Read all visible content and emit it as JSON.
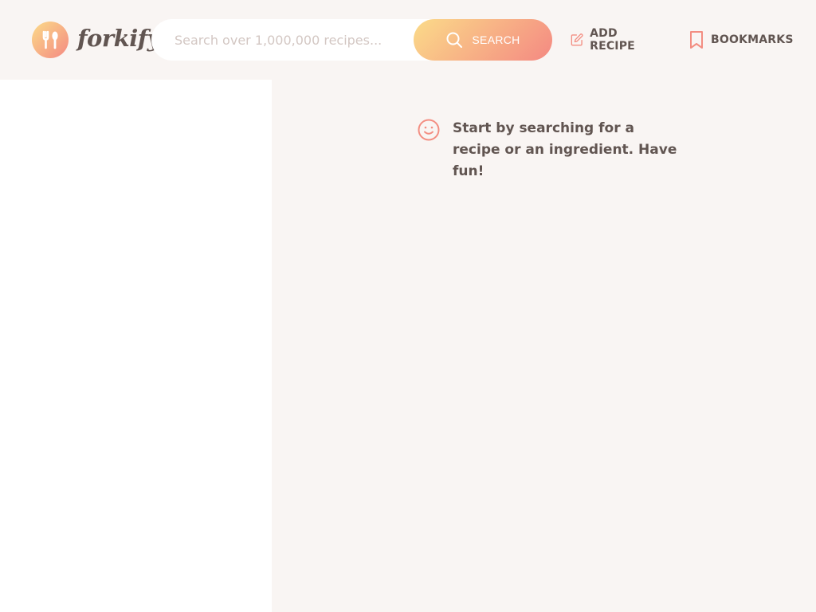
{
  "header": {
    "logo_text": "forkify",
    "search": {
      "placeholder": "Search over 1,000,000 recipes...",
      "button_label": "SEARCH"
    },
    "nav": {
      "add_recipe_label": "ADD RECIPE",
      "bookmarks_label": "BOOKMARKS"
    }
  },
  "recipe": {
    "message": "Start by searching for a recipe or an ingredient. Have fun!"
  },
  "colors": {
    "background": "#f9f5f3",
    "panel": "#ffffff",
    "accent_start": "#fbdb89",
    "accent_end": "#f48982",
    "text": "#615551",
    "placeholder": "#d3c7c3"
  },
  "icons": {
    "logo": "fork-knife-icon",
    "search": "search-icon",
    "add_recipe": "edit-icon",
    "bookmarks": "bookmark-icon",
    "message": "smile-icon"
  }
}
